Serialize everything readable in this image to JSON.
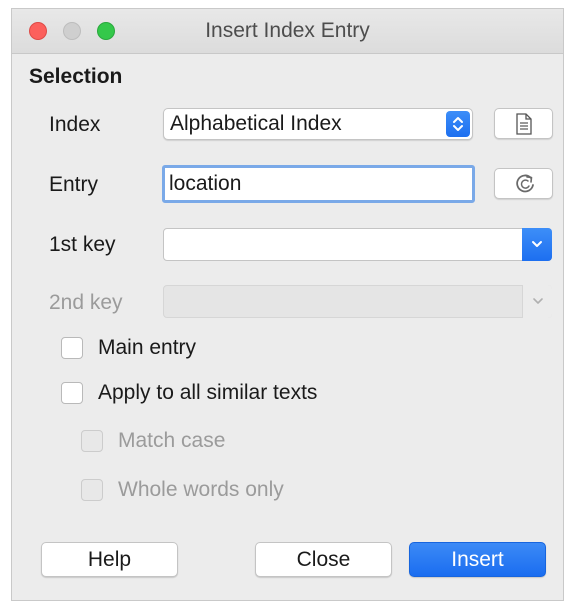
{
  "window": {
    "title": "Insert Index Entry"
  },
  "selection": {
    "heading": "Selection",
    "index": {
      "label": "Index",
      "value": "Alphabetical Index",
      "button_icon": "document-icon"
    },
    "entry": {
      "label": "Entry",
      "value": "location",
      "button_icon": "update-icon"
    },
    "key1": {
      "label": "1st key",
      "value": ""
    },
    "key2": {
      "label": "2nd key",
      "value": ""
    }
  },
  "options": {
    "main_entry": {
      "label": "Main entry",
      "checked": false
    },
    "apply_all": {
      "label": "Apply to all similar texts",
      "checked": false
    },
    "match_case": {
      "label": "Match case",
      "checked": false,
      "enabled": false
    },
    "whole_words": {
      "label": "Whole words only",
      "checked": false,
      "enabled": false
    }
  },
  "buttons": {
    "help": "Help",
    "close": "Close",
    "insert": "Insert"
  },
  "colors": {
    "accent": "#1d6ff0",
    "close_light": "#fc605c",
    "maximize_light": "#34c84a",
    "window_bg": "#ececec"
  }
}
